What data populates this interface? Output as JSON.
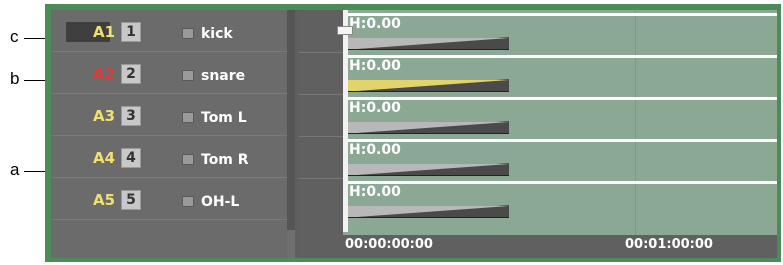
{
  "callouts": {
    "c": "c",
    "b": "b",
    "a": "a"
  },
  "tracks": [
    {
      "id": "A1",
      "number": "1",
      "name": "kick",
      "id_color": "#f0e070",
      "selected": true
    },
    {
      "id": "A2",
      "number": "2",
      "name": "snare",
      "id_color": "#e03a3a",
      "selected": false
    },
    {
      "id": "A3",
      "number": "3",
      "name": "Tom L",
      "id_color": "#f0e070",
      "selected": false
    },
    {
      "id": "A4",
      "number": "4",
      "name": "Tom R",
      "id_color": "#f0e070",
      "selected": false
    },
    {
      "id": "A5",
      "number": "5",
      "name": "OH-L",
      "id_color": "#f0e070",
      "selected": false
    }
  ],
  "clips": [
    {
      "label": "H:0.00",
      "wedge": "gray"
    },
    {
      "label": "H:0.00",
      "wedge": "yellow"
    },
    {
      "label": "H:0.00",
      "wedge": "gray"
    },
    {
      "label": "H:0.00",
      "wedge": "gray"
    },
    {
      "label": "H:0.00",
      "wedge": "gray"
    }
  ],
  "timecodes": {
    "start": "00:00:00:00",
    "mark": "00:01:00:00"
  },
  "colors": {
    "panel_border": "#4f8a5b",
    "clip_area": "#8aa894",
    "highlight_wedge": "#e2d36a"
  }
}
